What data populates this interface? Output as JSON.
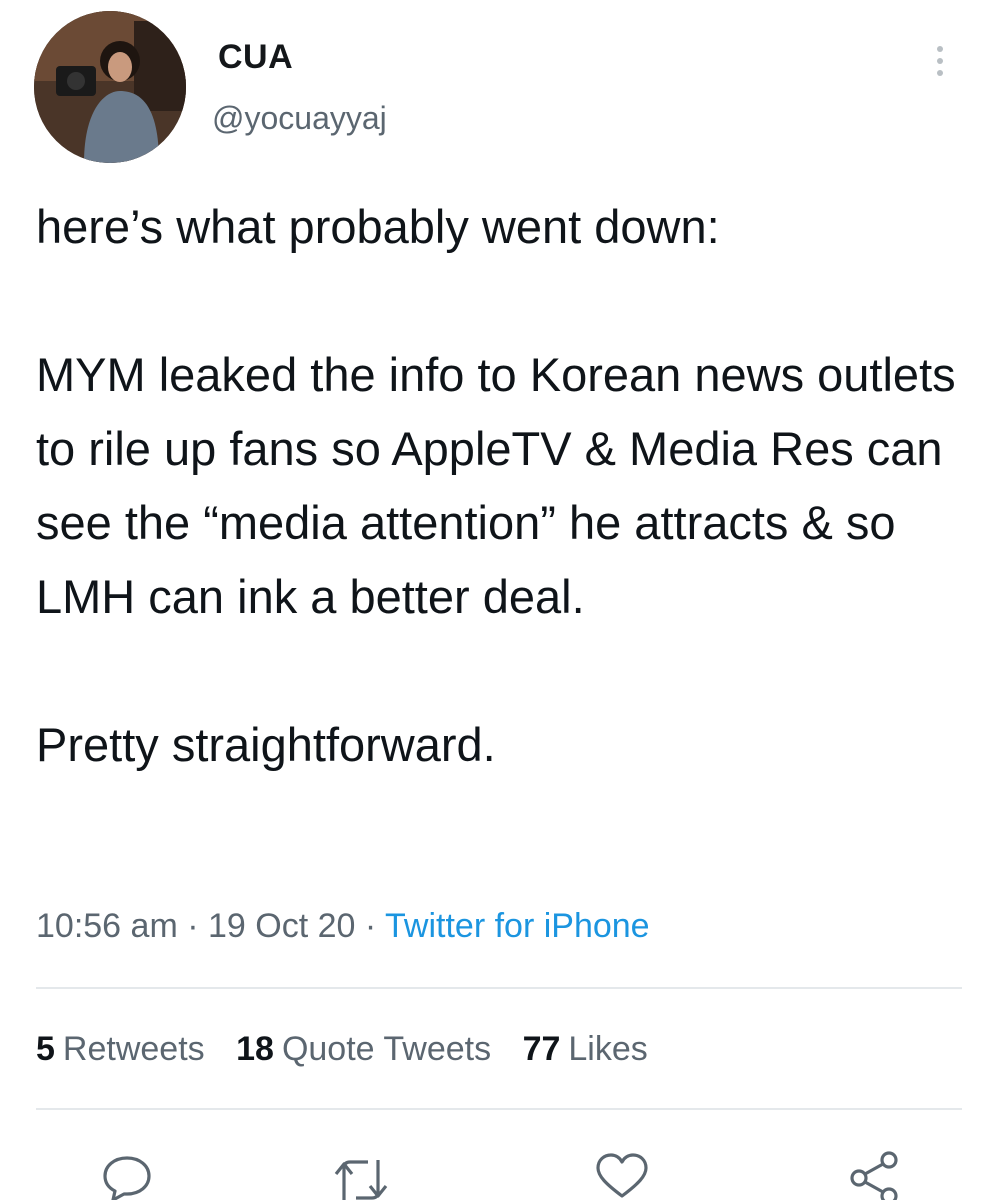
{
  "author": {
    "display_name": "CUA",
    "handle": "@yocuayyaj"
  },
  "tweet": {
    "text": "here’s what probably went down:\n\nMYM leaked the info to Korean news outlets to rile up fans so AppleTV & Media Res can see the “media attention” he attracts & so LMH can ink a better deal.\n\nPretty straightforward.",
    "time": "10:56 am",
    "date": "19 Oct 20",
    "source": "Twitter for iPhone",
    "separator": " · "
  },
  "stats": {
    "retweets_count": "5",
    "retweets_label": "Retweets",
    "quotes_count": "18",
    "quotes_label": "Quote Tweets",
    "likes_count": "77",
    "likes_label": "Likes"
  },
  "icons": {
    "more": "more-vertical-icon",
    "reply": "reply-icon",
    "retweet": "retweet-icon",
    "like": "heart-icon",
    "share": "share-icon"
  },
  "colors": {
    "text": "#0f1419",
    "secondary": "#5b6670",
    "link": "#1b95e0",
    "divider": "#e4e8eb"
  }
}
